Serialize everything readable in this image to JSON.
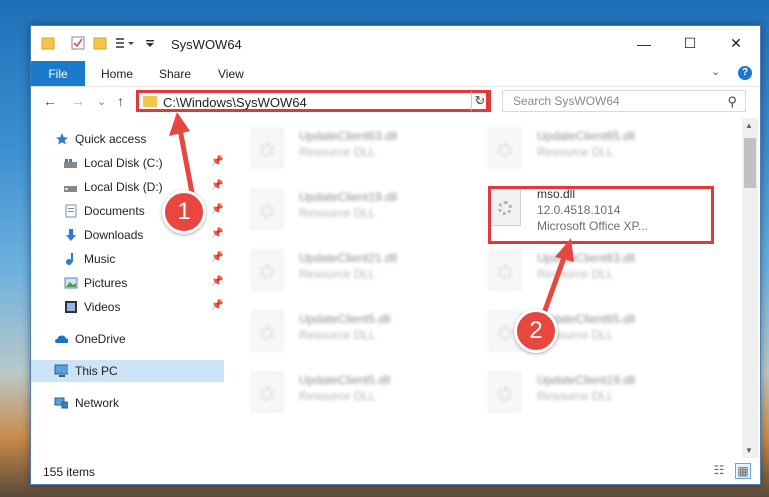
{
  "window": {
    "title": "SysWOW64",
    "minimize": "—",
    "maximize": "☐",
    "close": "✕"
  },
  "ribbon": {
    "tabs": [
      "File",
      "Home",
      "Share",
      "View"
    ],
    "help": "?"
  },
  "address": {
    "path": "C:\\Windows\\SysWOW64",
    "dropdown": "⌵",
    "refresh": "↻"
  },
  "search": {
    "placeholder": "Search SysWOW64"
  },
  "nav": {
    "back": "←",
    "forward": "→",
    "recent": "⌄",
    "up": "↑"
  },
  "sidebar": {
    "items": [
      {
        "label": "Quick access",
        "icon": "star-icon"
      },
      {
        "label": "Local Disk (C:)",
        "icon": "drive-icon",
        "pinned": true
      },
      {
        "label": "Local Disk (D:)",
        "icon": "drive-icon",
        "pinned": true
      },
      {
        "label": "Documents",
        "icon": "documents-icon",
        "pinned": true
      },
      {
        "label": "Downloads",
        "icon": "downloads-icon",
        "pinned": true
      },
      {
        "label": "Music",
        "icon": "music-icon",
        "pinned": true
      },
      {
        "label": "Pictures",
        "icon": "pictures-icon",
        "pinned": true
      },
      {
        "label": "Videos",
        "icon": "videos-icon",
        "pinned": true
      },
      {
        "label": "OneDrive",
        "icon": "onedrive-icon"
      },
      {
        "label": "This PC",
        "icon": "pc-icon",
        "selected": true
      },
      {
        "label": "Network",
        "icon": "network-icon"
      }
    ],
    "pin_glyph": "📌"
  },
  "files": [
    {
      "name": "UpdateClient63.dll",
      "type": "Resource DLL"
    },
    {
      "name": "UpdateClient65.dll",
      "type": "Resource DLL"
    },
    {
      "name": "UpdateClient19.dll",
      "type": "Resource DLL"
    },
    {
      "name": "mso.dll",
      "version": "12.0.4518.1014",
      "description": "Microsoft Office XP...",
      "highlighted": true
    },
    {
      "name": "UpdateClient21.dll",
      "type": "Resource DLL"
    },
    {
      "name": "UpdateClient63.dll",
      "type": "Resource DLL"
    },
    {
      "name": "UpdateClient5.dll",
      "type": "Resource DLL"
    },
    {
      "name": "UpdateClient65.dll",
      "type": "Resource DLL"
    },
    {
      "name": "UpdateClient5.dll",
      "type": "Resource DLL"
    },
    {
      "name": "UpdateClient19.dll",
      "type": "Resource DLL"
    }
  ],
  "status": {
    "item_count": "155 items"
  },
  "callouts": {
    "step1": "1",
    "step2": "2"
  },
  "colors": {
    "accent": "#1979ca",
    "highlight": "#e2383a",
    "selected_bg": "#cce4f7"
  }
}
